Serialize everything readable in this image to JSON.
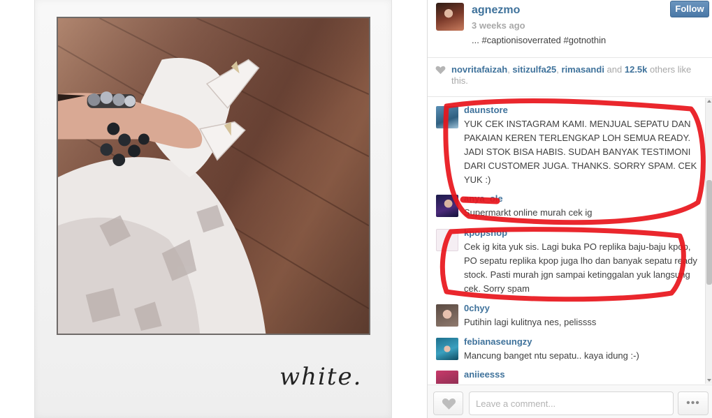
{
  "photo": {
    "alt": "Photo of white pointed shoes on a wooden floor",
    "handwriting": "white."
  },
  "post": {
    "author": "agnezmo",
    "time": "3 weeks ago",
    "caption": "... #captionisoverrated #gotnothin",
    "follow_label": "Follow"
  },
  "likes": {
    "likers": [
      "novritafaizah",
      "sitizulfa25",
      "rimasandi"
    ],
    "sep": ", ",
    "and": " and ",
    "count": "12.5k",
    "suffix": " others like this."
  },
  "comments": [
    {
      "user": "daunstore",
      "text": "YUK CEK INSTAGRAM KAMI. MENJUAL SEPATU DAN PAKAIAN KEREN TERLENGKAP LOH SEMUA READY. JADI STOK BISA HABIS. SUDAH BANYAK TESTIMONI DARI CUSTOMER JUGA. THANKS. SORRY SPAM. CEK YUK :)"
    },
    {
      "user": "anya_ole",
      "text": "Supermarkt online murah cek ig"
    },
    {
      "user": "kpopshop",
      "text": "Cek ig kita yuk sis. Lagi buka PO replika baju-baju kpop, PO sepatu replika kpop juga lho dan banyak sepatu ready stock. Pasti murah jgn sampai ketinggalan yuk langsung cek. Sorry spam"
    },
    {
      "user": "0chyy",
      "text": "Putihin lagi kulitnya nes, pelissss"
    },
    {
      "user": "febianaseungzy",
      "text": "Mancung banget ntu sepatu.. kaya idung :-)"
    },
    {
      "user": "aniieesss",
      "text": ""
    }
  ],
  "composer": {
    "placeholder": "Leave a comment...",
    "more_label": "•••"
  },
  "colors": {
    "link": "#3f729b",
    "follow": "#4a78a6",
    "annotation": "#e8151b"
  }
}
